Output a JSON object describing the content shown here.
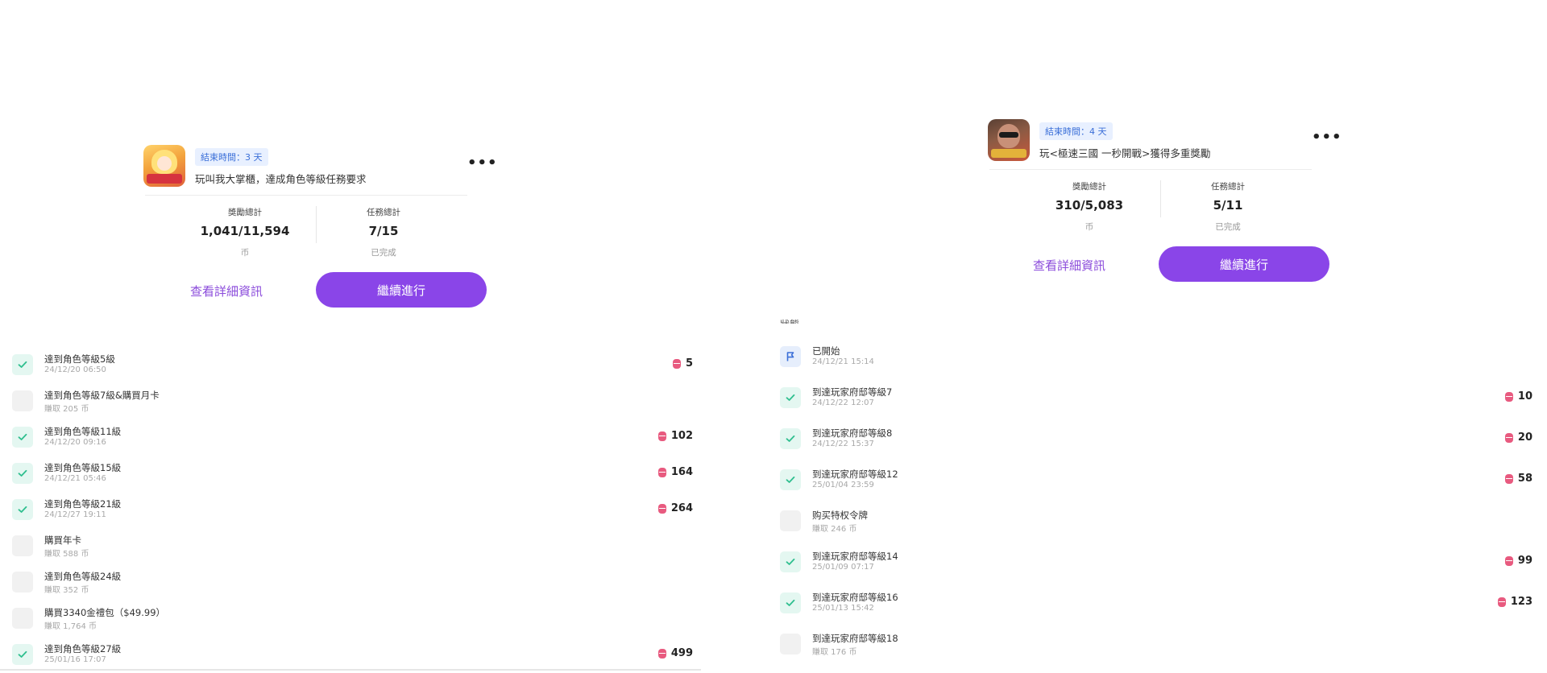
{
  "colors": {
    "accent": "#8a45e8",
    "check_bg": "#e4f7f1",
    "check_mark": "#2fbf8f",
    "coin": "#e85a7f",
    "badge_bg": "#e8f0ff",
    "badge_text": "#3b6fd8"
  },
  "left_card": {
    "app_icon": "anime-girl-game-icon",
    "badge": "結束時間：3 天",
    "title": "玩叫我大掌櫃，達成角色等級任務要求",
    "more_label": "•••",
    "reward_label": "獎勵總計",
    "reward_value": "1,041/11,594",
    "reward_unit": "币",
    "task_label": "任務總計",
    "task_value": "7/15",
    "task_unit": "已完成",
    "detail_link": "查看詳細資訊",
    "continue_button": "繼續進行"
  },
  "right_card": {
    "app_icon": "man-sunglasses-game-icon",
    "badge": "結束時間：4 天",
    "title": "玩<極速三國 一秒開戰>獲得多重獎勵",
    "more_label": "•••",
    "reward_label": "獎勵總計",
    "reward_value": "310/5,083",
    "reward_unit": "币",
    "task_label": "任務總計",
    "task_value": "5/11",
    "task_unit": "已完成",
    "detail_link": "查看詳細資訊",
    "continue_button": "繼續進行"
  },
  "left_list": [
    {
      "name": "達到角色等級5級",
      "sub": "24/12/20 06:50",
      "done": true,
      "reward": "5"
    },
    {
      "name": "達到角色等級7級&購買月卡",
      "sub": "賺取 205 币",
      "done": false,
      "reward": ""
    },
    {
      "name": "達到角色等級11級",
      "sub": "24/12/20 09:16",
      "done": true,
      "reward": "102"
    },
    {
      "name": "達到角色等級15級",
      "sub": "24/12/21 05:46",
      "done": true,
      "reward": "164"
    },
    {
      "name": "達到角色等級21級",
      "sub": "24/12/27 19:11",
      "done": true,
      "reward": "264"
    },
    {
      "name": "購買年卡",
      "sub": "賺取 588 币",
      "done": false,
      "reward": ""
    },
    {
      "name": "達到角色等級24級",
      "sub": "賺取 352 币",
      "done": false,
      "reward": ""
    },
    {
      "name": "購買3340金禮包（$49.99）",
      "sub": "賺取 1,764 币",
      "done": false,
      "reward": ""
    },
    {
      "name": "達到角色等級27級",
      "sub": "25/01/16 17:07",
      "done": true,
      "reward": "499"
    }
  ],
  "right_list_header": "狀態",
  "right_list": [
    {
      "name": "已開始",
      "sub": "24/12/21 15:14",
      "state": "flag",
      "reward": ""
    },
    {
      "name": "到達玩家府邸等級7",
      "sub": "24/12/22 12:07",
      "state": "done",
      "reward": "10"
    },
    {
      "name": "到達玩家府邸等級8",
      "sub": "24/12/22 15:37",
      "state": "done",
      "reward": "20"
    },
    {
      "name": "到達玩家府邸等級12",
      "sub": "25/01/04 23:59",
      "state": "done",
      "reward": "58"
    },
    {
      "name": "购买特权令牌",
      "sub": "賺取 246 币",
      "state": "todo",
      "reward": ""
    },
    {
      "name": "到達玩家府邸等級14",
      "sub": "25/01/09 07:17",
      "state": "done",
      "reward": "99"
    },
    {
      "name": "到達玩家府邸等級16",
      "sub": "25/01/13 15:42",
      "state": "done",
      "reward": "123"
    },
    {
      "name": "到達玩家府邸等級18",
      "sub": "賺取 176 币",
      "state": "todo",
      "reward": ""
    }
  ]
}
